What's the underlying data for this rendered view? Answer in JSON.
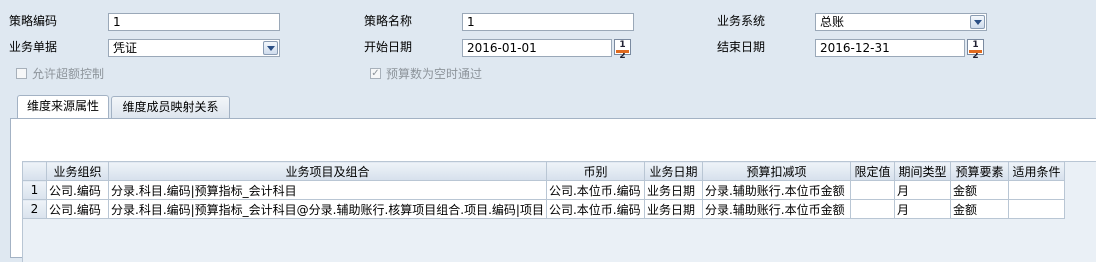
{
  "form": {
    "strategy_code": {
      "label": "策略编码",
      "value": "1"
    },
    "strategy_name": {
      "label": "策略名称",
      "value": "1"
    },
    "business_system": {
      "label": "业务系统",
      "value": "总账"
    },
    "business_document": {
      "label": "业务单据",
      "value": "凭证"
    },
    "start_date": {
      "label": "开始日期",
      "value": "2016-01-01"
    },
    "end_date": {
      "label": "结束日期",
      "value": "2016-12-31"
    },
    "allow_overrun": {
      "label": "允许超额控制",
      "checked": false
    },
    "budget_empty_pass": {
      "label": "预算数为空时通过",
      "checked": true
    }
  },
  "calendar_icon_text": "1 2",
  "tabs": [
    {
      "label": "维度来源属性",
      "active": true
    },
    {
      "label": "维度成员映射关系",
      "active": false
    }
  ],
  "grid": {
    "columns": [
      "业务组织",
      "业务项目及组合",
      "币别",
      "业务日期",
      "预算扣减项",
      "限定值",
      "期间类型",
      "预算要素",
      "适用条件"
    ],
    "rows": [
      {
        "num": "1",
        "cells": [
          "公司.编码",
          "分录.科目.编码|预算指标_会计科目",
          "公司.本位币.编码",
          "业务日期",
          "分录.辅助账行.本位币金额",
          "",
          "月",
          "金额",
          ""
        ]
      },
      {
        "num": "2",
        "cells": [
          "公司.编码",
          "分录.科目.编码|预算指标_会计科目@分录.辅助账行.核算项目组合.项目.编码|项目",
          "公司.本位币.编码",
          "业务日期",
          "分录.辅助账行.本位币金额",
          "",
          "月",
          "金额",
          ""
        ]
      }
    ]
  }
}
